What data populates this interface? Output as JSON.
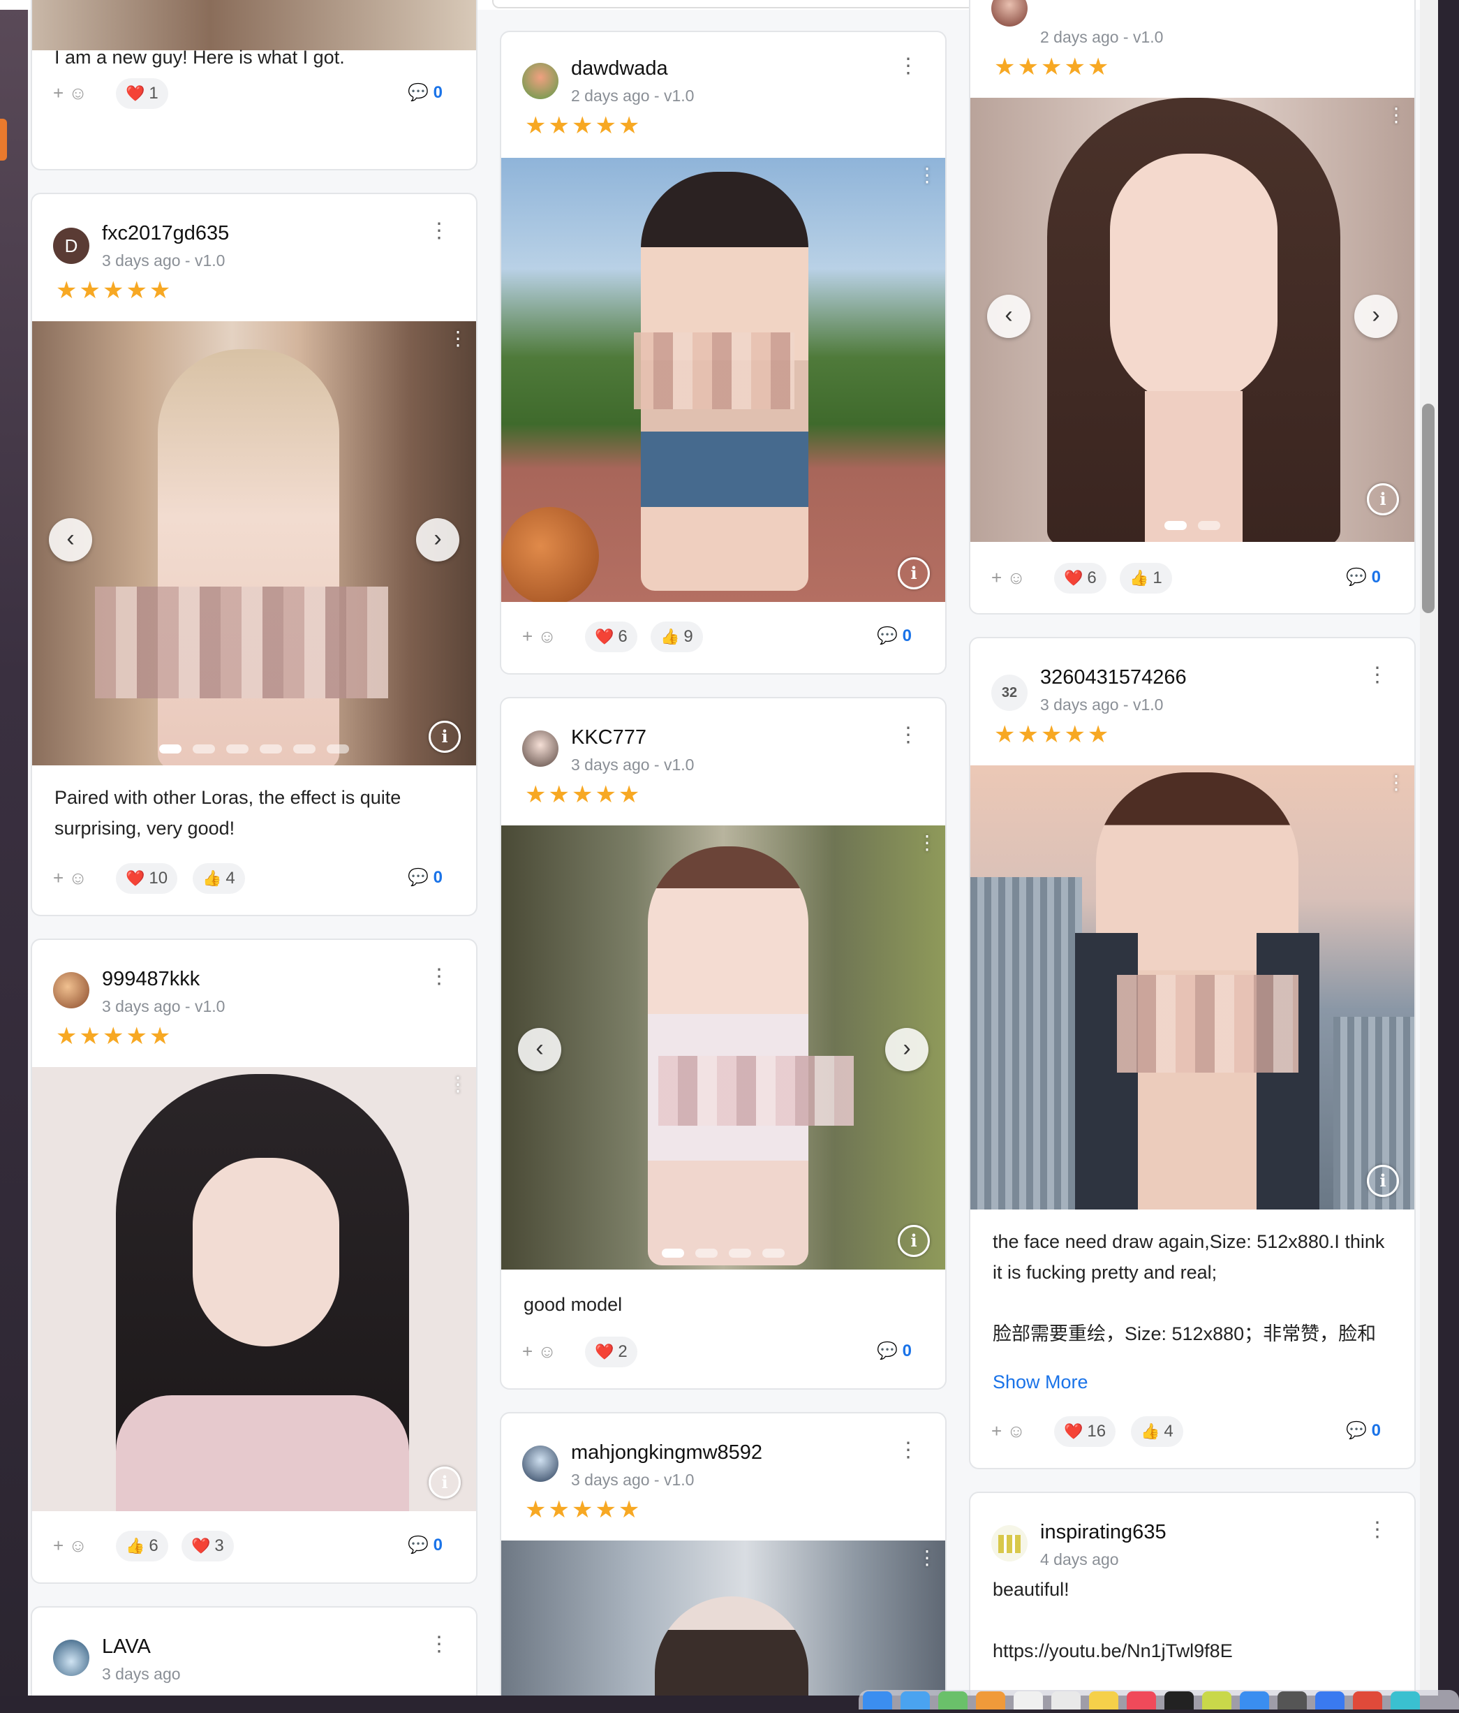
{
  "cards": {
    "c1": {
      "text": "I am a new guy! Here is what I got.",
      "reactions": [
        {
          "emoji": "❤️",
          "count": "1"
        }
      ],
      "comments": "0"
    },
    "c2": {
      "user": "fxc2017gd635",
      "avatar_letter": "D",
      "meta": "3 days ago - v1.0",
      "stars": "★★★★★",
      "text": "Paired with other Loras, the effect is quite surprising, very good!",
      "reactions": [
        {
          "emoji": "❤️",
          "count": "10"
        },
        {
          "emoji": "👍",
          "count": "4"
        }
      ],
      "comments": "0"
    },
    "c3": {
      "user": "999487kkk",
      "meta": "3 days ago - v1.0",
      "stars": "★★★★★",
      "reactions": [
        {
          "emoji": "👍",
          "count": "6"
        },
        {
          "emoji": "❤️",
          "count": "3"
        }
      ],
      "comments": "0"
    },
    "c4": {
      "user": "LAVA",
      "meta": "3 days ago"
    },
    "c5": {
      "user": "dawdwada",
      "meta": "2 days ago - v1.0",
      "stars": "★★★★★",
      "reactions": [
        {
          "emoji": "❤️",
          "count": "6"
        },
        {
          "emoji": "👍",
          "count": "9"
        }
      ],
      "comments": "0"
    },
    "c6": {
      "user": "KKC777",
      "meta": "3 days ago - v1.0",
      "stars": "★★★★★",
      "text": "good model",
      "reactions": [
        {
          "emoji": "❤️",
          "count": "2"
        }
      ],
      "comments": "0"
    },
    "c7": {
      "user": "mahjongkingmw8592",
      "meta": "3 days ago - v1.0",
      "stars": "★★★★★"
    },
    "c8": {
      "meta": "2 days ago - v1.0",
      "stars": "★★★★★",
      "reactions": [
        {
          "emoji": "❤️",
          "count": "6"
        },
        {
          "emoji": "👍",
          "count": "1"
        }
      ],
      "comments": "0"
    },
    "c9": {
      "user": "3260431574266",
      "avatar_text": "32",
      "meta": "3 days ago - v1.0",
      "stars": "★★★★★",
      "text": "the face need draw again,Size: 512x880.I think it is fucking pretty and real;\n\n脸部需要重绘，Size: 512x880；非常赞，脸和身材没得说",
      "show_more": "Show More",
      "reactions": [
        {
          "emoji": "❤️",
          "count": "16"
        },
        {
          "emoji": "👍",
          "count": "4"
        }
      ],
      "comments": "0"
    },
    "c10": {
      "user": "inspirating635",
      "meta": "4 days ago",
      "text": "beautiful!\n\nhttps://youtu.be/Nn1jTwl9f8E"
    }
  },
  "ui": {
    "add_reaction": "+ ☺",
    "kebab": "⋮",
    "prev": "‹",
    "next": "›",
    "info": "i",
    "comment_icon": "comment-bubble-icon"
  },
  "colors": {
    "accent": "#1a73e8",
    "star": "#f7a823"
  }
}
